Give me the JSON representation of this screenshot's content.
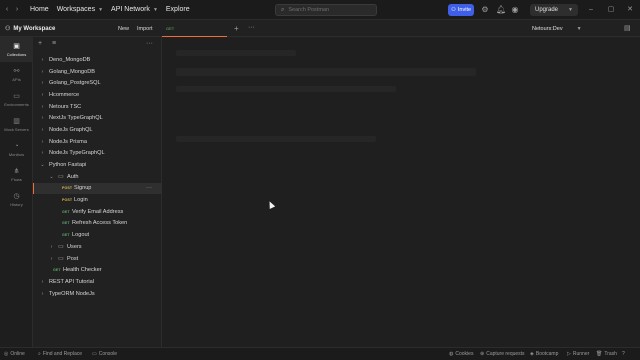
{
  "topbar": {
    "nav": [
      "Home",
      "Workspaces",
      "API Network",
      "Explore"
    ],
    "search_placeholder": "Search Postman",
    "invite_label": "Invite",
    "upgrade_label": "Upgrade"
  },
  "workspace": {
    "name": "My Workspace",
    "new_label": "New",
    "import_label": "Import"
  },
  "tabs": {
    "active_method": "GET",
    "environment": "Netours:Dev"
  },
  "rail": [
    {
      "label": "Collections",
      "icon": "collections-icon",
      "active": true
    },
    {
      "label": "APIs",
      "icon": "apis-icon"
    },
    {
      "label": "Environments",
      "icon": "environments-icon"
    },
    {
      "label": "Mock Servers",
      "icon": "mock-servers-icon"
    },
    {
      "label": "Monitors",
      "icon": "monitors-icon"
    },
    {
      "label": "Flows",
      "icon": "flows-icon"
    },
    {
      "label": "History",
      "icon": "history-icon"
    }
  ],
  "tree": [
    {
      "type": "collection",
      "label": "Deno_MongoDB",
      "depth": 0,
      "open": false
    },
    {
      "type": "collection",
      "label": "Golang_MongoDB",
      "depth": 0,
      "open": false
    },
    {
      "type": "collection",
      "label": "Golang_PostgreSQL",
      "depth": 0,
      "open": false
    },
    {
      "type": "collection",
      "label": "Hcommerce",
      "depth": 0,
      "open": false
    },
    {
      "type": "collection",
      "label": "Netours TSC",
      "depth": 0,
      "open": false
    },
    {
      "type": "collection",
      "label": "NextJs TypeGraphQL",
      "depth": 0,
      "open": false
    },
    {
      "type": "collection",
      "label": "NodeJs GraphQL",
      "depth": 0,
      "open": false
    },
    {
      "type": "collection",
      "label": "NodeJs Prisma",
      "depth": 0,
      "open": false
    },
    {
      "type": "collection",
      "label": "NodeJs TypeGraphQL",
      "depth": 0,
      "open": false
    },
    {
      "type": "collection",
      "label": "Python Fastapi",
      "depth": 0,
      "open": true
    },
    {
      "type": "folder",
      "label": "Auth",
      "depth": 1,
      "open": true
    },
    {
      "type": "request",
      "method": "POST",
      "label": "Signup",
      "depth": 2,
      "selected": true
    },
    {
      "type": "request",
      "method": "POST",
      "label": "Login",
      "depth": 2
    },
    {
      "type": "request",
      "method": "GET",
      "label": "Verify Email Address",
      "depth": 2
    },
    {
      "type": "request",
      "method": "GET",
      "label": "Refresh Access Token",
      "depth": 2
    },
    {
      "type": "request",
      "method": "GET",
      "label": "Logout",
      "depth": 2
    },
    {
      "type": "folder",
      "label": "Users",
      "depth": 1,
      "open": false
    },
    {
      "type": "folder",
      "label": "Post",
      "depth": 1,
      "open": false
    },
    {
      "type": "request",
      "method": "GET",
      "label": "Health Checker",
      "depth": 1
    },
    {
      "type": "collection",
      "label": "REST API Tutorial",
      "depth": 0,
      "open": false
    },
    {
      "type": "collection",
      "label": "TypeORM NodeJs",
      "depth": 0,
      "open": false
    }
  ],
  "bottombar": {
    "left": [
      "Online",
      "Find and Replace",
      "Console"
    ],
    "right": [
      "Cookies",
      "Capture requests",
      "Bootcamp",
      "Runner",
      "Trash"
    ]
  },
  "colors": {
    "accent": "#f26b3a",
    "invite": "#3f5fe8",
    "post": "#d9b84d",
    "get": "#5fa86a"
  }
}
